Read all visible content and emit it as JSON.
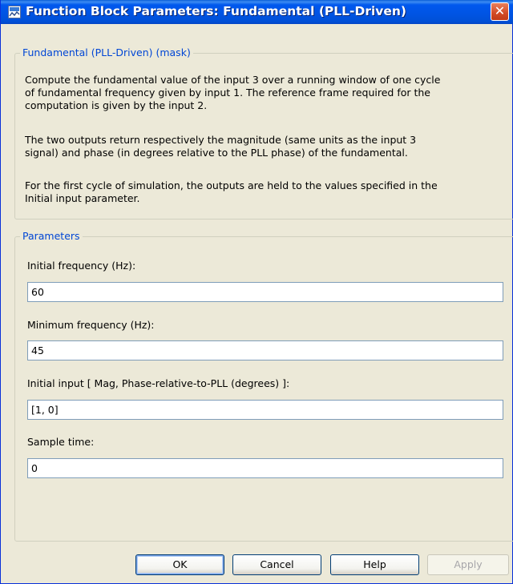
{
  "window": {
    "title": "Function Block Parameters: Fundamental (PLL-Driven)",
    "close_symbol": "✕"
  },
  "description_group": {
    "legend": "Fundamental (PLL-Driven) (mask)",
    "paragraphs": [
      [
        "Compute the fundamental value of the input 3 over a running window of one cycle",
        "of fundamental frequency given by input 1. The reference frame required for the",
        "computation is given by the input 2."
      ],
      [
        "The two outputs return respectively the magnitude (same units as the input 3",
        "signal) and phase (in degrees relative to the PLL phase) of the fundamental."
      ],
      [
        "For the first cycle of simulation, the outputs are held to the values specified in the",
        "Initial input parameter."
      ]
    ]
  },
  "parameters_group": {
    "legend": "Parameters",
    "fields": [
      {
        "label": "Initial frequency (Hz):",
        "value": "60"
      },
      {
        "label": "Minimum frequency (Hz):",
        "value": "45"
      },
      {
        "label": "Initial input [ Mag,  Phase-relative-to-PLL (degrees) ]:",
        "value": "[1, 0]"
      },
      {
        "label": "Sample time:",
        "value": "0"
      }
    ]
  },
  "buttons": {
    "ok": "OK",
    "cancel": "Cancel",
    "help": "Help",
    "apply": "Apply"
  },
  "icons": {
    "title_icon": "simulink-block-icon",
    "close_icon": "close-icon"
  },
  "colors": {
    "titlebar": "#0054e3",
    "legend_text": "#0046d5",
    "close_button": "#d24a25"
  }
}
